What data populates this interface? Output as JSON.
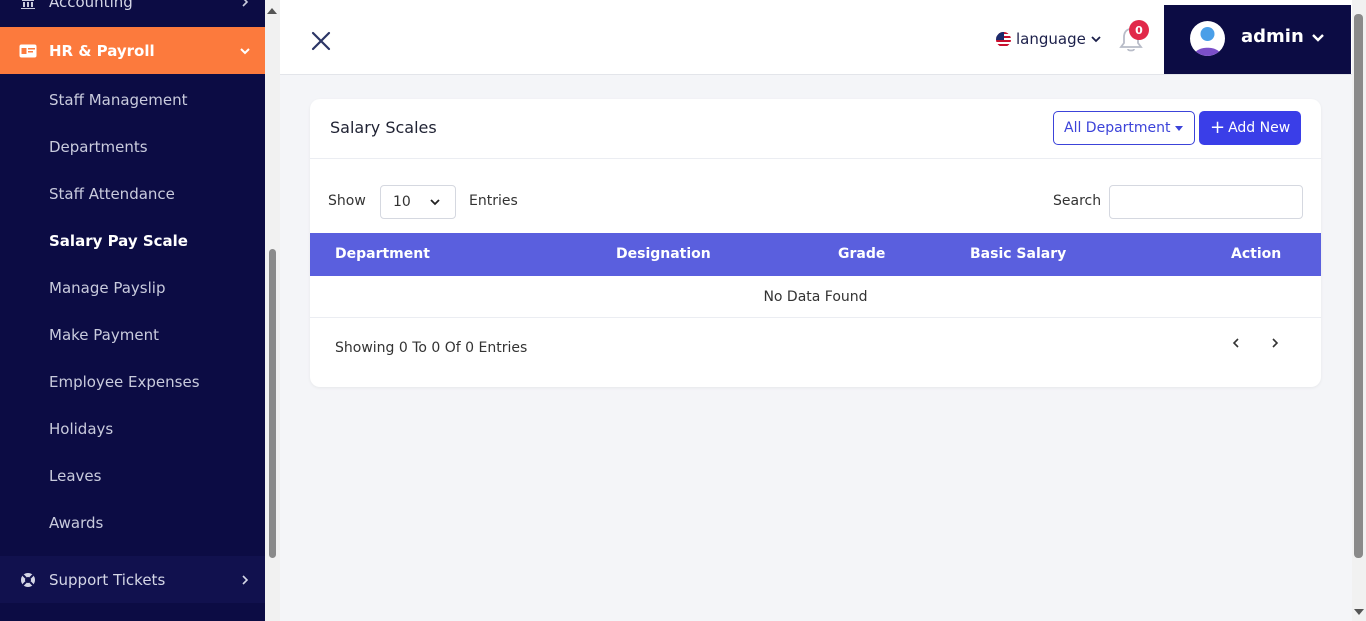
{
  "sidebar": {
    "accounting_label": "Accounting",
    "hr_label": "HR & Payroll",
    "sub_items": [
      {
        "label": "Staff Management"
      },
      {
        "label": "Departments"
      },
      {
        "label": "Staff Attendance"
      },
      {
        "label": "Salary Pay Scale",
        "active": true
      },
      {
        "label": "Manage Payslip"
      },
      {
        "label": "Make Payment"
      },
      {
        "label": "Employee Expenses"
      },
      {
        "label": "Holidays"
      },
      {
        "label": "Leaves"
      },
      {
        "label": "Awards"
      }
    ],
    "support_label": "Support Tickets"
  },
  "topbar": {
    "language_label": "language",
    "notification_count": "0",
    "user_name": "admin"
  },
  "card": {
    "title": "Salary Scales",
    "department_filter": "All Department",
    "add_label": "Add New",
    "show_label": "Show",
    "entries_value": "10",
    "entries_label": "Entries",
    "search_label": "Search",
    "search_value": "",
    "columns": [
      "Department",
      "Designation",
      "Grade",
      "Basic Salary",
      "Action"
    ],
    "empty_message": "No Data Found",
    "footer_text": "Showing 0 To 0 Of 0 Entries"
  },
  "colors": {
    "sidebar_bg": "#0c0c44",
    "accent_orange": "#fc7a3d",
    "primary_blue": "#3a3ee8",
    "table_header": "#5a5fde",
    "badge_red": "#e1294a"
  }
}
